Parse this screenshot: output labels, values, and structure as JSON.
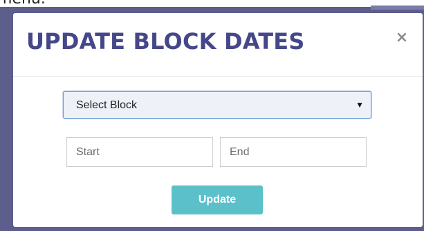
{
  "page": {
    "top_text": "menu.",
    "colors": {
      "backdrop": "#5d5e8c",
      "title": "#45478a",
      "accent": "#5bc0ca",
      "select_border": "#6a9ad2"
    }
  },
  "modal": {
    "title": "UPDATE BLOCK DATES",
    "close_icon": "close-icon",
    "close_glyph": "×",
    "select": {
      "selected_value": "Select Block",
      "caret_icon": "caret-down-icon",
      "caret_glyph": "▼"
    },
    "start_input": {
      "value": "",
      "placeholder": "Start"
    },
    "end_input": {
      "value": "",
      "placeholder": "End"
    },
    "update_label": "Update"
  }
}
